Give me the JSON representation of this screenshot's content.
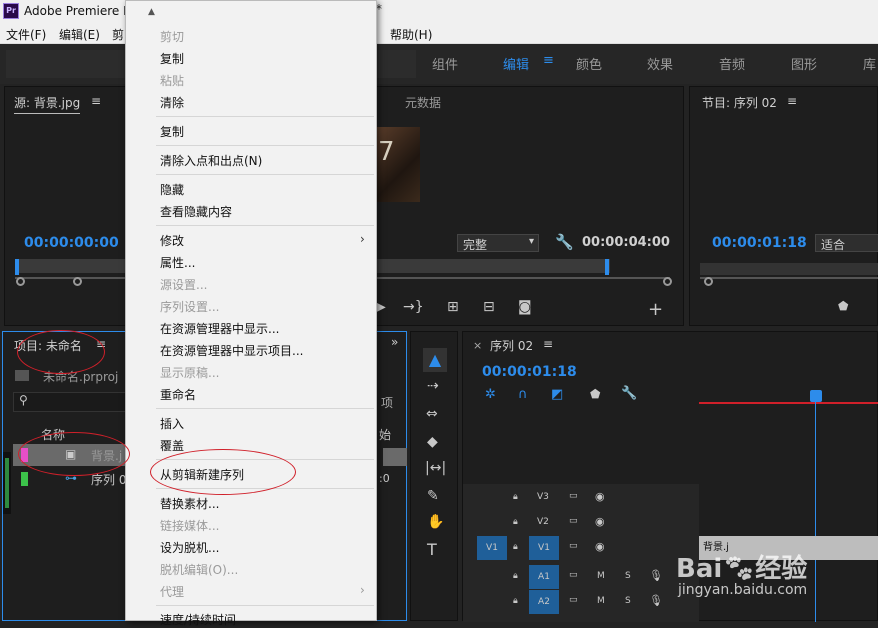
{
  "app": {
    "title": "Adobe Premiere P",
    "logo": "Pr"
  },
  "menubar": {
    "file": "文件(F)",
    "edit": "编辑(E)",
    "clip": "剪",
    "help": "帮助(H)"
  },
  "workspaces": {
    "items": [
      "组件",
      "编辑",
      "颜色",
      "效果",
      "音频",
      "图形",
      "库"
    ],
    "active": "编辑"
  },
  "source_panel": {
    "title": "源: 背景.jpg",
    "metadata_tab": "元数据",
    "timecode_in": "00:00:00:00",
    "zoom": "完整",
    "duration": "00:00:04:00"
  },
  "program_panel": {
    "title": "节目: 序列 02",
    "timecode": "00:00:01:18",
    "zoom": "适合"
  },
  "project_panel": {
    "title": "项目: 未命名",
    "file": "未命名.prproj",
    "col_name": "名称",
    "col_start": "始",
    "col_x": "项",
    "items": [
      "背景.j",
      "序列 0"
    ],
    "val": ":0"
  },
  "timeline": {
    "tab": "序列 02",
    "timecode": "00:00:01:18",
    "tracks": [
      "V3",
      "V2",
      "V1",
      "A1",
      "A2"
    ],
    "src_v": "V1",
    "src_a": "A1",
    "m": "M",
    "s": "S",
    "clip_label": "背景.j"
  },
  "context_menu": {
    "items": [
      {
        "label": "剪切",
        "disabled": true
      },
      {
        "label": "复制",
        "disabled": false
      },
      {
        "label": "粘贴",
        "disabled": true
      },
      {
        "label": "清除",
        "disabled": false
      },
      {
        "label": "复制",
        "disabled": false
      },
      {
        "label": "清除入点和出点(N)",
        "disabled": false
      },
      {
        "label": "隐藏",
        "disabled": false
      },
      {
        "label": "查看隐藏内容",
        "disabled": false
      },
      {
        "label": "修改",
        "disabled": false
      },
      {
        "label": "属性...",
        "disabled": false
      },
      {
        "label": "源设置...",
        "disabled": true
      },
      {
        "label": "序列设置...",
        "disabled": true
      },
      {
        "label": "在资源管理器中显示...",
        "disabled": false
      },
      {
        "label": "在资源管理器中显示项目...",
        "disabled": false
      },
      {
        "label": "显示原稿...",
        "disabled": true
      },
      {
        "label": "重命名",
        "disabled": false
      },
      {
        "label": "插入",
        "disabled": false
      },
      {
        "label": "覆盖",
        "disabled": false
      },
      {
        "label": "从剪辑新建序列",
        "disabled": false
      },
      {
        "label": "替换素材...",
        "disabled": false
      },
      {
        "label": "链接媒体...",
        "disabled": true
      },
      {
        "label": "设为脱机...",
        "disabled": false
      },
      {
        "label": "脱机编辑(O)...",
        "disabled": true
      },
      {
        "label": "代理",
        "disabled": true
      },
      {
        "label": "速度/持续时间",
        "disabled": false
      }
    ]
  },
  "watermark": {
    "line1": "Bai",
    "line1b": "经验",
    "line2": "jingyan.baidu.com"
  },
  "colors": {
    "accent": "#2d8ceb",
    "annotation": "#d0202a",
    "playhead": "#2d8ceb"
  }
}
